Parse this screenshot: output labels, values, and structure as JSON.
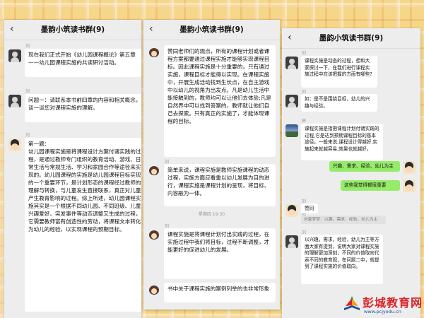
{
  "header": {
    "title": "墨韵小筑读书群(9)",
    "back_icon": "chevron-left-icon"
  },
  "phone1": {
    "messages": [
      {
        "sender": "刘凤",
        "text": "现在我们正式开始《幼儿园课程概论》第五章——幼儿园课程实施的共读研讨活动。"
      },
      {
        "sender": "刘凤",
        "text": "问题一：请联系本书前四章的内容和相关概念，谈一谈您对课程实施的理解。"
      },
      {
        "sender": "刘洋阳",
        "text": "第一题：\n幼儿园课程实施是将课程设计方案付诸实践的过程，是通过教师专门组织的教育活动、游戏、日常生活与常规生活、学习和家园合作等途径来实现的。幼儿园课程的实施是幼儿园课程目标实现的一个重要环节，是计划形态的课程经过教师的理解与转换，与儿童发生直接联系，真正对儿童产生教育影响的过程。综上所述，幼儿园课程实施其实是一个根据不同幼儿园、不同班级、儿童兴趣爱好、突发事件等动态调整又生成的过程，它需要教师富有创造性的劳动，将课程文本转化为幼儿的经验，以实现课程的预期目标。"
      }
    ]
  },
  "phone2": {
    "messages": [
      {
        "sender": "",
        "text": "赞同老师们的观点，所有的课程计划或者课程方案都要通过课程实施才能够实现课程目标。因此课程实施是十分重要的，只有通过实施，课程目标才能得以实现。在课程实施中，开展生成活动找到生长点，在自主游戏中以幼儿的视角为出发点。凡是幼儿生活中能接触到的，教师均可以让他们去体验;凡是自然界中可以找到答案的，教师就让他们自己去探索。只有真正的实施了，才能体现课程的目标。"
      },
      {
        "sender": "刘凤",
        "text": "简单来说，课程实施是教师实施课程的动态过程，实施方面应看重以幼儿发展为目的进行，课程实施是课程计划的呈现，将目标、内容融为一体。"
      },
      {
        "sender": "刘凤",
        "text": "课程实施是将课程计划付出实践的过程，在实施过程中我们将目标，过程不断调整，才能更好的促进幼儿的发展。"
      },
      {
        "sender": "刘凤",
        "text": "书中关于课程实施的案例列举的也非常形象"
      }
    ],
    "time": "星期四 19:30"
  },
  "phone3": {
    "messages": [
      {
        "sender": "刘凤",
        "text": "课程实施是动态的过程，想和大家探讨一下，在我们进行课程实施过程中应该把握的方面有哪些?"
      },
      {
        "sender": "刘凤",
        "text": "如：是不是围绕目标，幼儿的兴趣与经验。"
      },
      {
        "sender": "薛琳",
        "text": "课程实施是指把课程计划付诸实践的过程,它是达到预期课程目标的基本途径。一般来说,课程设计得越好,实施起来就越容易,效果也就越好。"
      },
      {
        "sender": "",
        "text": "兴趣、需求、经验、幼儿为主",
        "own": true
      },
      {
        "sender": "",
        "text": "这些我觉得都很重要",
        "own": true
      },
      {
        "sender": "刘洋阳",
        "text": "赞同"
      },
      {
        "sender": "",
        "text": "刘夏梦梦：兴趣，需求，经验，幼儿为主",
        "quote": true
      },
      {
        "sender": "刘凤",
        "text": "以兴趣，需求，经验，幼儿为主等方面大家有提到，说明大家对课程实施的理解更加深刻，不同的价值取向代表不同的教育观，在问题二中，就提到了课程实施的价值取向。"
      }
    ]
  },
  "watermark": {
    "text": "彭城教育网",
    "url": "www.pcjyedu.cn"
  }
}
